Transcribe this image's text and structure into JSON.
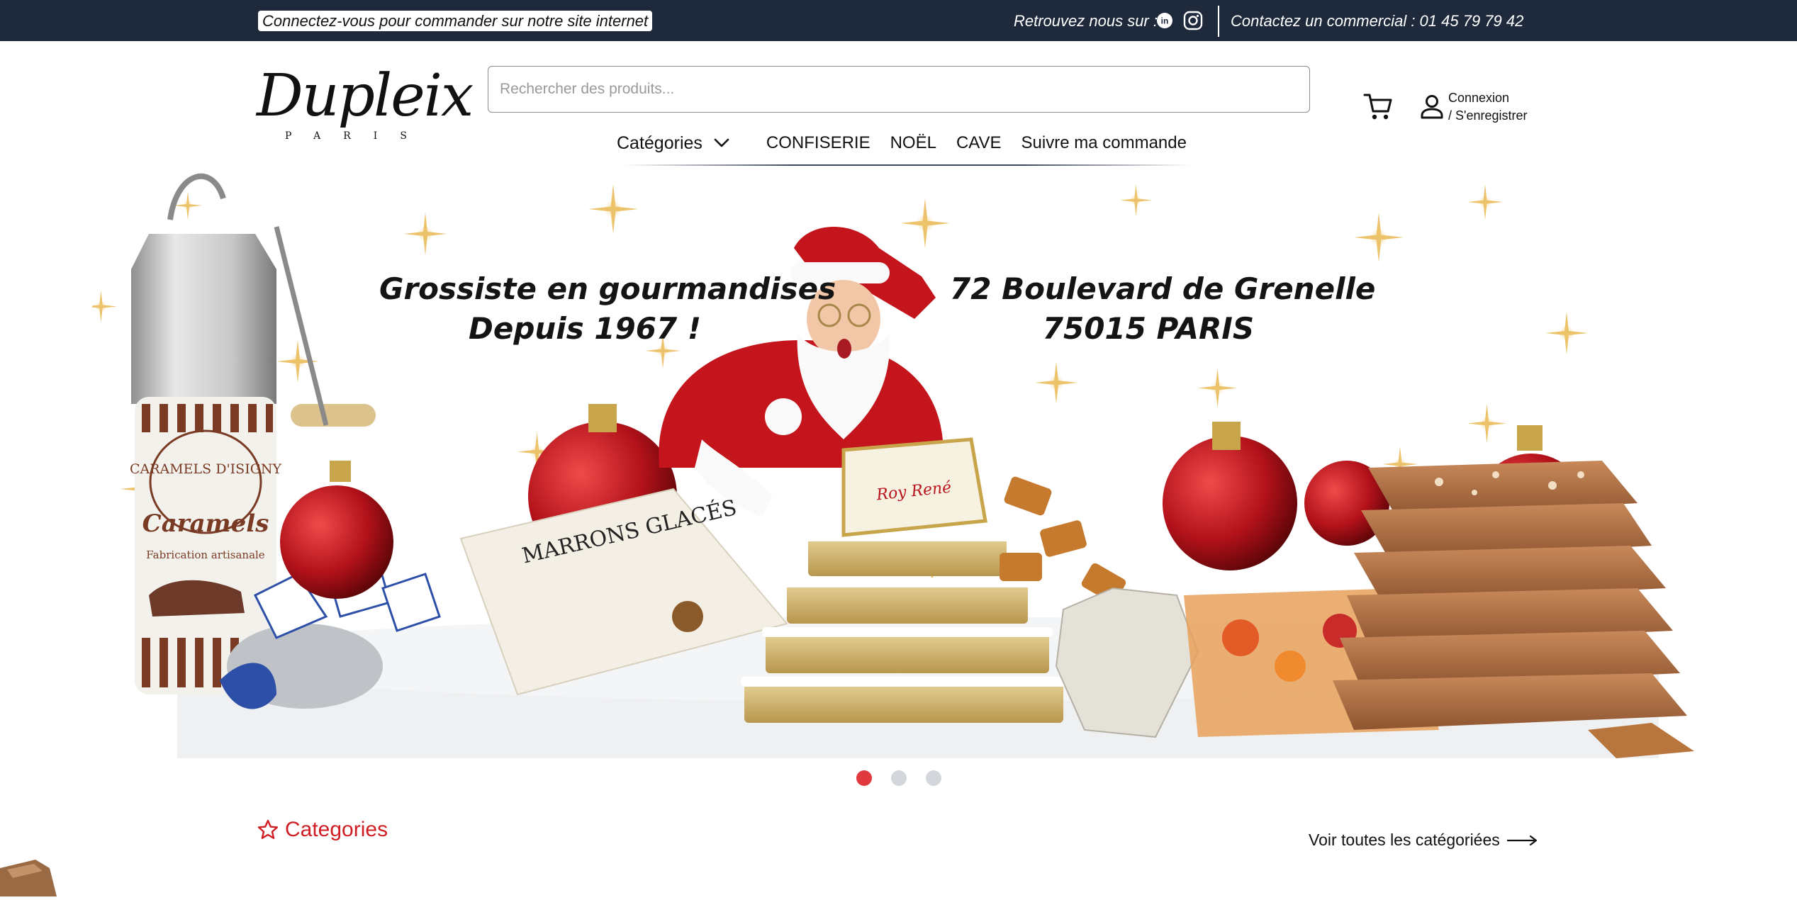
{
  "topbar": {
    "login_message": "Connectez-vous pour commander sur notre site internet",
    "follow_label": "Retrouvez nous sur :",
    "socials": [
      "linkedin-icon",
      "instagram-icon"
    ],
    "contact": "Contactez un commercial : 01 45 79 79 42",
    "background": "#1e2a3c"
  },
  "logo": {
    "script": "Dupleix",
    "sub": "PARIS"
  },
  "search": {
    "placeholder": "Rechercher des produits..."
  },
  "account": {
    "login": "Connexion",
    "register": "/ S'enregistrer"
  },
  "nav": {
    "categories_label": "Catégories",
    "links": [
      "CONFISERIE",
      "NOËL",
      "CAVE",
      "Suivre ma commande"
    ]
  },
  "hero": {
    "left_line1": "Grossiste en gourmandises",
    "left_line2": "Depuis 1967 !",
    "right_line1": "72 Boulevard de Grenelle",
    "right_line2": "75015 PARIS",
    "product_labels": {
      "tin_brand": "CARAMELS D'ISIGNY",
      "tin_title": "Caramels",
      "tin_sub": "Fabrication artisanale",
      "box": "MARRONS GLACÉS",
      "calisson_box": "Roy René"
    },
    "slides": 3,
    "active_slide": 1
  },
  "section": {
    "title": "Categories",
    "see_all": "Voir toutes les catégoriées"
  },
  "colors": {
    "accent": "#e03a3e",
    "section_title": "#cf1f25",
    "topbar": "#1e2a3c"
  }
}
